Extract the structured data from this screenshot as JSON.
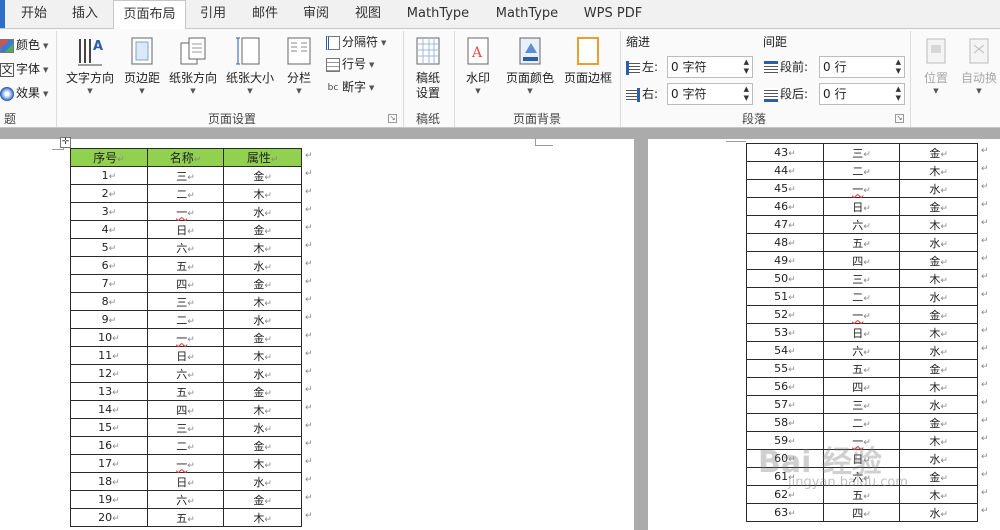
{
  "tabs": [
    "开始",
    "插入",
    "页面布局",
    "引用",
    "邮件",
    "审阅",
    "视图",
    "MathType",
    "MathType",
    "WPS PDF"
  ],
  "active_tab": "页面布局",
  "ribbon": {
    "theme_group": {
      "label": "题",
      "colors": "颜色",
      "fonts": "字体",
      "effects": "效果"
    },
    "page_setup": {
      "label": "页面设置",
      "text_direction": "文字方向",
      "margins": "页边距",
      "orientation": "纸张方向",
      "size": "纸张大小",
      "columns": "分栏",
      "breaks": "分隔符",
      "line_numbers": "行号",
      "hyphenation": "断字"
    },
    "manuscript": {
      "label": "稿纸",
      "button_line1": "稿纸",
      "button_line2": "设置"
    },
    "page_background": {
      "label": "页面背景",
      "watermark": "水印",
      "page_color": "页面颜色",
      "page_borders": "页面边框"
    },
    "paragraph": {
      "label": "段落",
      "indent_title": "缩进",
      "spacing_title": "间距",
      "indent_left_label": "左:",
      "indent_left_value": "0 字符",
      "indent_right_label": "右:",
      "indent_right_value": "0 字符",
      "space_before_label": "段前:",
      "space_before_value": "0 行",
      "space_after_label": "段后:",
      "space_after_value": "0 行"
    },
    "arrange": {
      "position": "位置",
      "wrap_text": "自动换"
    }
  },
  "table": {
    "headers": [
      "序号",
      "名称",
      "属性"
    ],
    "rows_page1": [
      [
        "1",
        "三",
        "金"
      ],
      [
        "2",
        "二",
        "木"
      ],
      [
        "3",
        "一",
        "水"
      ],
      [
        "4",
        "日",
        "金"
      ],
      [
        "5",
        "六",
        "木"
      ],
      [
        "6",
        "五",
        "水"
      ],
      [
        "7",
        "四",
        "金"
      ],
      [
        "8",
        "三",
        "木"
      ],
      [
        "9",
        "二",
        "水"
      ],
      [
        "10",
        "一",
        "金"
      ],
      [
        "11",
        "日",
        "木"
      ],
      [
        "12",
        "六",
        "水"
      ],
      [
        "13",
        "五",
        "金"
      ],
      [
        "14",
        "四",
        "木"
      ],
      [
        "15",
        "三",
        "水"
      ],
      [
        "16",
        "二",
        "金"
      ],
      [
        "17",
        "一",
        "木"
      ],
      [
        "18",
        "日",
        "水"
      ],
      [
        "19",
        "六",
        "金"
      ],
      [
        "20",
        "五",
        "木"
      ]
    ],
    "rows_page2": [
      [
        "43",
        "三",
        "金"
      ],
      [
        "44",
        "二",
        "木"
      ],
      [
        "45",
        "一",
        "水"
      ],
      [
        "46",
        "日",
        "金"
      ],
      [
        "47",
        "六",
        "木"
      ],
      [
        "48",
        "五",
        "水"
      ],
      [
        "49",
        "四",
        "金"
      ],
      [
        "50",
        "三",
        "木"
      ],
      [
        "51",
        "二",
        "水"
      ],
      [
        "52",
        "一",
        "金"
      ],
      [
        "53",
        "日",
        "木"
      ],
      [
        "54",
        "六",
        "水"
      ],
      [
        "55",
        "五",
        "金"
      ],
      [
        "56",
        "四",
        "木"
      ],
      [
        "57",
        "三",
        "水"
      ],
      [
        "58",
        "二",
        "金"
      ],
      [
        "59",
        "一",
        "木"
      ],
      [
        "60",
        "日",
        "水"
      ],
      [
        "61",
        "六",
        "金"
      ],
      [
        "62",
        "五",
        "木"
      ],
      [
        "63",
        "四",
        "水"
      ]
    ]
  },
  "watermark_text": "Bai 经验",
  "watermark_url": "jingyan.baidu.com",
  "colors": {
    "header_green": "#92d050",
    "tab_accent": "#2f6ec6"
  }
}
